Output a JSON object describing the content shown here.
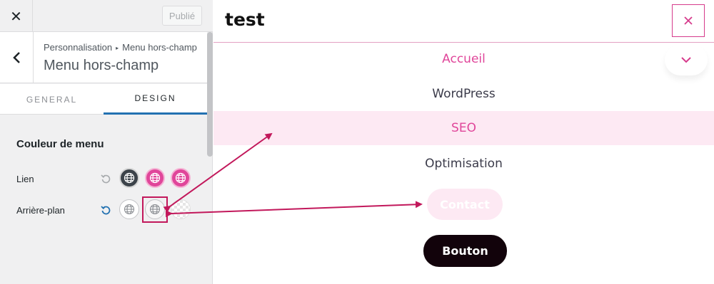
{
  "topbar": {
    "close_label": "✕",
    "publish_label": "Publié"
  },
  "section": {
    "breadcrumb_parent": "Personnalisation",
    "breadcrumb_separator": "▸",
    "breadcrumb_current": "Menu hors-champ",
    "title": "Menu hors-champ"
  },
  "tabs": [
    {
      "label": "GENERAL",
      "active": false
    },
    {
      "label": "DESIGN",
      "active": true
    }
  ],
  "menu_color": {
    "title": "Couleur de menu",
    "rows": [
      {
        "label": "Lien",
        "swatches": [
          "#3c434a",
          "#e0469a",
          "#e0469a"
        ]
      },
      {
        "label": "Arrière-plan",
        "swatches": [
          "#ffffff",
          "#f7f7f7",
          "transparent"
        ]
      }
    ]
  },
  "preview": {
    "site_title": "test",
    "menu_items": [
      {
        "label": "Accueil",
        "state": "current"
      },
      {
        "label": "WordPress",
        "state": "normal"
      },
      {
        "label": "SEO",
        "state": "hover"
      },
      {
        "label": "Optimisation",
        "state": "normal"
      }
    ],
    "contact_label": "Contact",
    "button_label": "Bouton"
  },
  "colors": {
    "accent_pink": "#e0469a",
    "hover_bg": "#fde9f3",
    "active_tab": "#2271b1",
    "annotation": "#c2185b"
  }
}
